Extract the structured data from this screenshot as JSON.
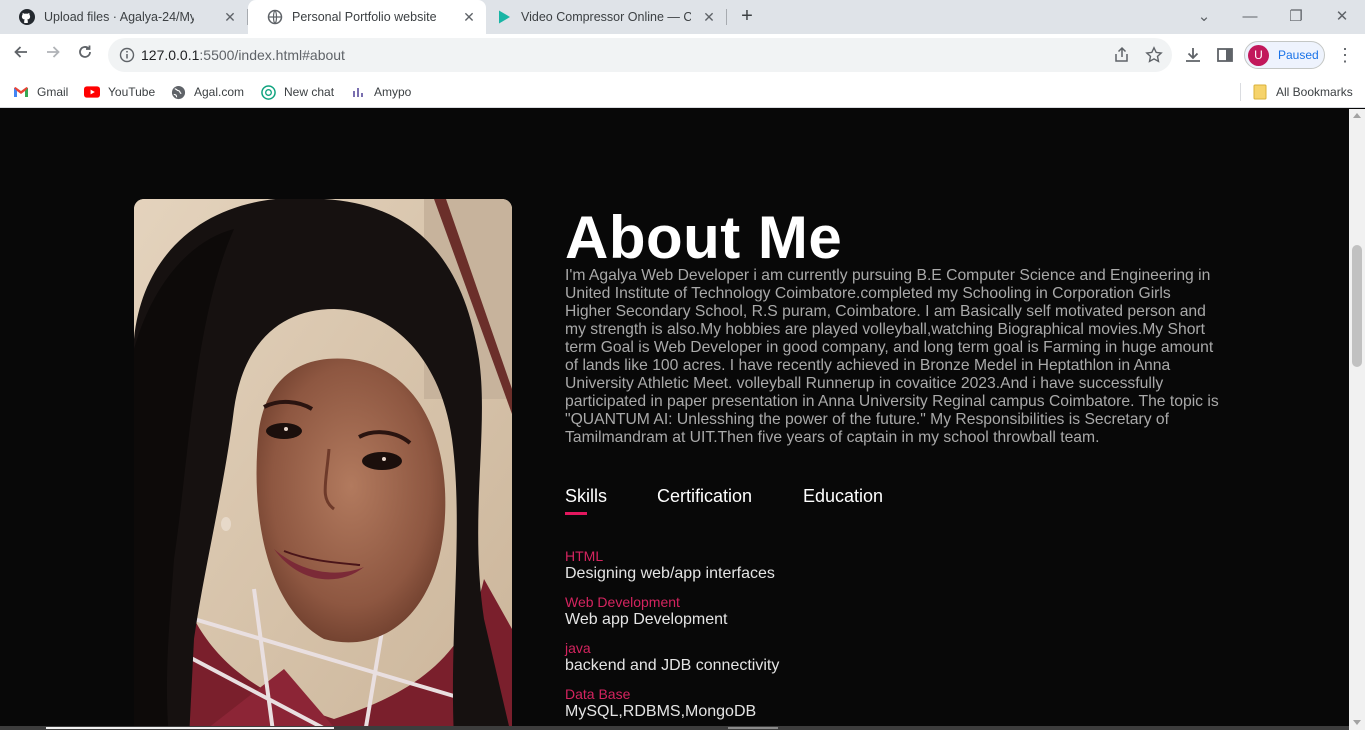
{
  "browser": {
    "tabs": [
      {
        "title": "Upload files · Agalya-24/MyInter",
        "icon": "github-icon",
        "active": false
      },
      {
        "title": "Personal Portfolio website",
        "icon": "globe-icon",
        "active": true
      },
      {
        "title": "Video Compressor Online — Clic",
        "icon": "play-icon",
        "active": false
      }
    ],
    "url_host": "127.0.0.1",
    "url_path": ":5500/index.html#about",
    "profile_initial": "U",
    "profile_status": "Paused",
    "bookmarks": [
      {
        "label": "Gmail",
        "icon": "gmail-icon"
      },
      {
        "label": "YouTube",
        "icon": "youtube-icon"
      },
      {
        "label": "Agal.com",
        "icon": "globe-icon"
      },
      {
        "label": "New chat",
        "icon": "chatgpt-icon"
      },
      {
        "label": "Amypo",
        "icon": "amypo-icon"
      }
    ],
    "all_bookmarks": "All Bookmarks"
  },
  "about": {
    "title": "About Me",
    "text": "I'm Agalya Web Developer i am currently pursuing B.E Computer Science and Engineering in United Institute of Technology Coimbatore.completed my Schooling in Corporation Girls Higher Secondary School, R.S puram, Coimbatore. I am Basically self motivated person and my strength is also.My hobbies are played volleyball,watching Biographical movies.My Short term Goal is Web Developer in good company, and long term goal is Farming in huge amount of lands like 100 acres. I have recently achieved in Bronze Medel in Heptathlon in Anna University Athletic Meet. volleyball Runnerup in covaitice 2023.And i have successfully participated in paper presentation in Anna University Reginal campus Coimbatore. The topic is \"QUANTUM AI: Unlesshing the power of the future.\" My Responsibilities is Secretary of Tamilmandram at UIT.Then five years of captain in my school throwball team.",
    "tabs": [
      "Skills",
      "Certification",
      "Education"
    ],
    "active_tab": "Skills",
    "skills": [
      {
        "name": "HTML",
        "desc": "Designing web/app interfaces"
      },
      {
        "name": "Web Development",
        "desc": "Web app Development"
      },
      {
        "name": "java",
        "desc": "backend and JDB connectivity"
      },
      {
        "name": "Data Base",
        "desc": "MySQL,RDBMS,MongoDB"
      }
    ]
  },
  "colors": {
    "accent": "#e3175e",
    "background": "#080808",
    "body_text": "#a9a9a9"
  }
}
